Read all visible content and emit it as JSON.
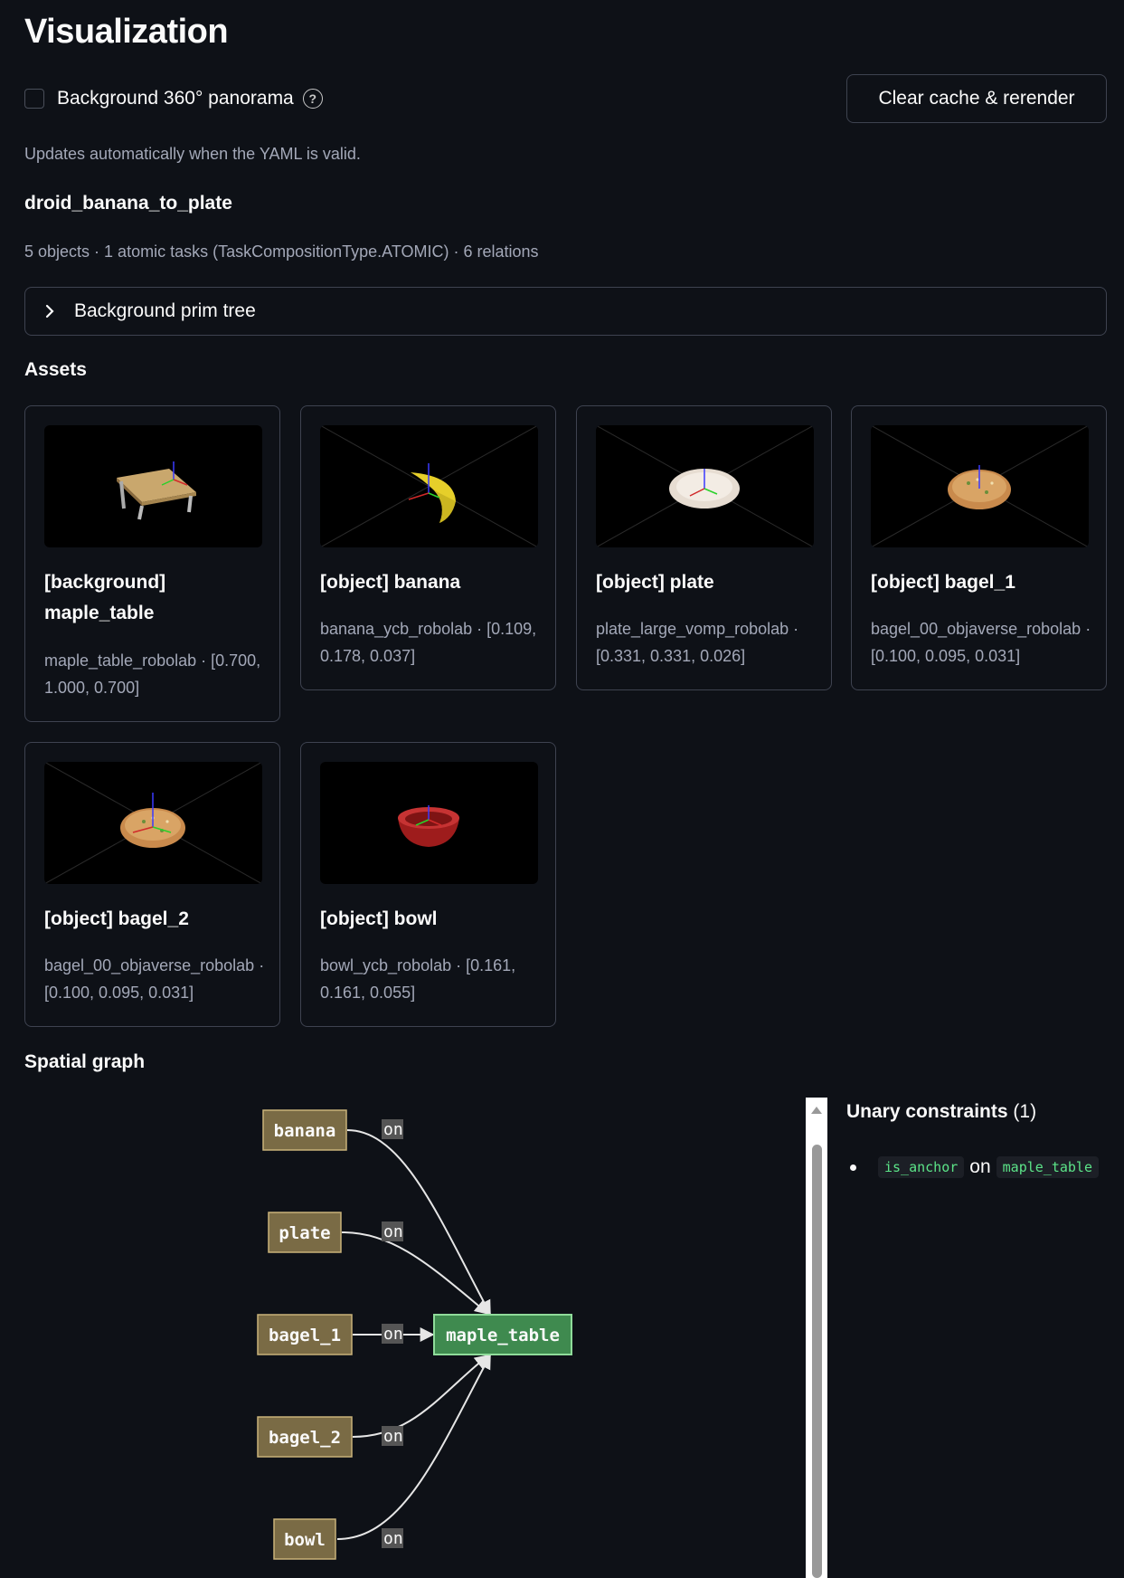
{
  "page": {
    "title": "Visualization"
  },
  "controls": {
    "panorama_label": "Background 360° panorama",
    "help_glyph": "?",
    "clear_button": "Clear cache & rerender"
  },
  "caption": "Updates automatically when the YAML is valid.",
  "scene": {
    "name": "droid_banana_to_plate",
    "summary": "5 objects · 1 atomic tasks (TaskCompositionType.ATOMIC) · 6 relations"
  },
  "expander": {
    "label": "Background prim tree"
  },
  "assets": {
    "heading": "Assets",
    "cards": [
      {
        "title": "[background] maple_table",
        "meta": "maple_table_robolab · [0.700, 1.000, 0.700]",
        "thumb_icon": "table-icon"
      },
      {
        "title": "[object] banana",
        "meta": "banana_ycb_robolab · [0.109, 0.178, 0.037]",
        "thumb_icon": "banana-icon"
      },
      {
        "title": "[object] plate",
        "meta": "plate_large_vomp_robolab · [0.331, 0.331, 0.026]",
        "thumb_icon": "plate-icon"
      },
      {
        "title": "[object] bagel_1",
        "meta": "bagel_00_objaverse_robolab · [0.100, 0.095, 0.031]",
        "thumb_icon": "bagel-icon"
      },
      {
        "title": "[object] bagel_2",
        "meta": "bagel_00_objaverse_robolab · [0.100, 0.095, 0.031]",
        "thumb_icon": "bagel-icon"
      },
      {
        "title": "[object] bowl",
        "meta": "bowl_ycb_robolab · [0.161, 0.161, 0.055]",
        "thumb_icon": "bowl-icon"
      }
    ]
  },
  "spatial_graph": {
    "heading": "Spatial graph",
    "nodes": [
      "banana",
      "plate",
      "bagel_1",
      "bagel_2",
      "bowl"
    ],
    "target": "maple_table",
    "edge_label": "on",
    "node_color": "#7a6b45",
    "target_color": "#3f8a4f"
  },
  "unary": {
    "title": "Unary constraints",
    "count": "(1)",
    "items": [
      {
        "constraint": "is_anchor",
        "joiner": "on",
        "object": "maple_table"
      }
    ]
  }
}
